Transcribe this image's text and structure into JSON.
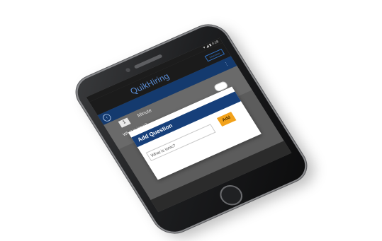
{
  "status_bar": {
    "text": "▾ ◢ ▮ 4:18"
  },
  "header": {
    "brand": "QuikHiring",
    "badge": "Interview"
  },
  "nav": {
    "back_icon": "chevron-left-icon",
    "menu_icon": "more-icon"
  },
  "form": {
    "number_value": "1",
    "unit_label": "Minute",
    "question_text": "What is ionic?"
  },
  "modal": {
    "title": "Add Question",
    "input_value": "What is ionic?",
    "add_label": "Add"
  },
  "colors": {
    "header_blue": "#163f7a",
    "button_orange": "#f2a21b",
    "brand_blue": "#5a8dd6"
  }
}
